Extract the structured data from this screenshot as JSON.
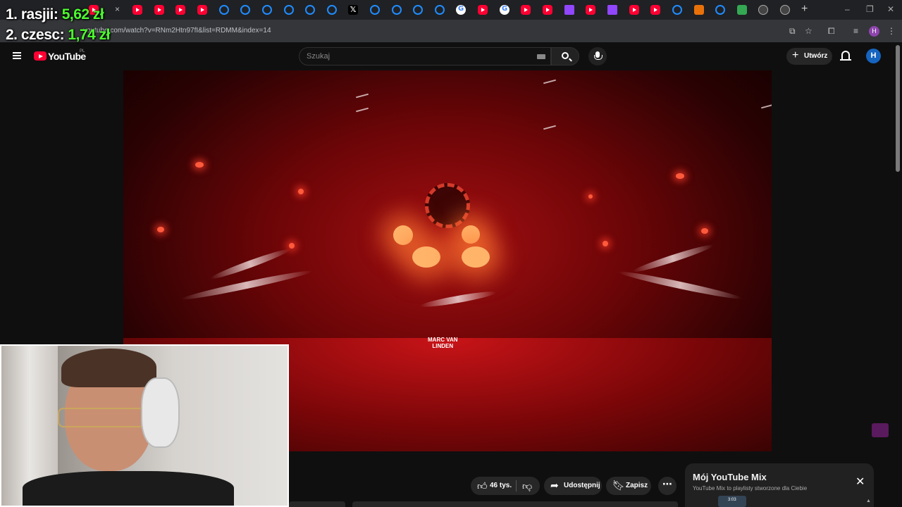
{
  "overlay": {
    "line1_label": "1. rasjii: ",
    "line1_value": "5,62 zł",
    "line2_label": "2. czesc: ",
    "line2_value": "1,74 zł"
  },
  "browser": {
    "url": "youtube.com/watch?v=RNm2Htn97fI&list=RDMM&index=14",
    "new_tab": "+",
    "tab_close": "×"
  },
  "youtube": {
    "logo_text": "YouTube",
    "country": "PL",
    "search_placeholder": "Szukaj",
    "create_label": "Utwórz",
    "avatar_letter": "H",
    "profile_letter": "H"
  },
  "video": {
    "banner": "MARC VAN\nLINDEN"
  },
  "actions": {
    "like_count": "46 tys.",
    "share_label": "Udostępnij",
    "save_label": "Zapisz"
  },
  "mix": {
    "title": "Mój YouTube Mix",
    "subtitle": "YouTube Mix to playlisty stworzone dla Ciebie",
    "duration": "3:03"
  },
  "colors": {
    "overlay_value": "#4dff2e",
    "youtube_red": "#ff0033",
    "background": "#0f0f0f"
  }
}
